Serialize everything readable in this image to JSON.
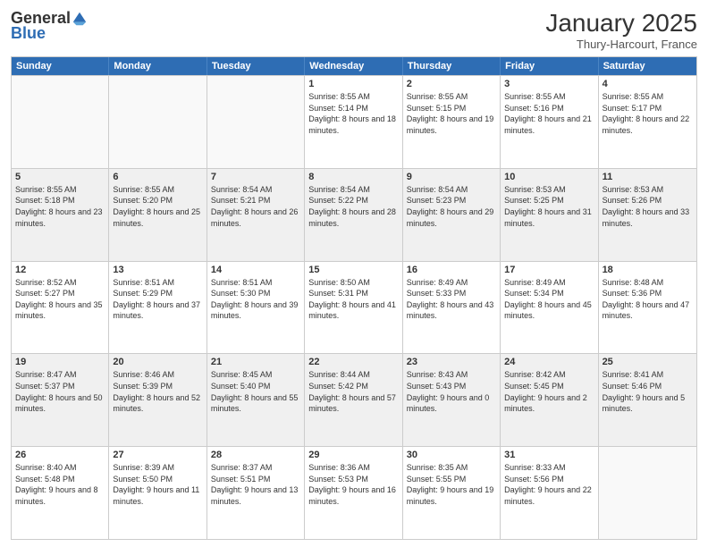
{
  "logo": {
    "general": "General",
    "blue": "Blue"
  },
  "header": {
    "month": "January 2025",
    "location": "Thury-Harcourt, France"
  },
  "weekdays": [
    "Sunday",
    "Monday",
    "Tuesday",
    "Wednesday",
    "Thursday",
    "Friday",
    "Saturday"
  ],
  "rows": [
    [
      {
        "day": "",
        "sunrise": "",
        "sunset": "",
        "daylight": "",
        "empty": true
      },
      {
        "day": "",
        "sunrise": "",
        "sunset": "",
        "daylight": "",
        "empty": true
      },
      {
        "day": "",
        "sunrise": "",
        "sunset": "",
        "daylight": "",
        "empty": true
      },
      {
        "day": "1",
        "sunrise": "Sunrise: 8:55 AM",
        "sunset": "Sunset: 5:14 PM",
        "daylight": "Daylight: 8 hours and 18 minutes."
      },
      {
        "day": "2",
        "sunrise": "Sunrise: 8:55 AM",
        "sunset": "Sunset: 5:15 PM",
        "daylight": "Daylight: 8 hours and 19 minutes."
      },
      {
        "day": "3",
        "sunrise": "Sunrise: 8:55 AM",
        "sunset": "Sunset: 5:16 PM",
        "daylight": "Daylight: 8 hours and 21 minutes."
      },
      {
        "day": "4",
        "sunrise": "Sunrise: 8:55 AM",
        "sunset": "Sunset: 5:17 PM",
        "daylight": "Daylight: 8 hours and 22 minutes."
      }
    ],
    [
      {
        "day": "5",
        "sunrise": "Sunrise: 8:55 AM",
        "sunset": "Sunset: 5:18 PM",
        "daylight": "Daylight: 8 hours and 23 minutes.",
        "shaded": true
      },
      {
        "day": "6",
        "sunrise": "Sunrise: 8:55 AM",
        "sunset": "Sunset: 5:20 PM",
        "daylight": "Daylight: 8 hours and 25 minutes.",
        "shaded": true
      },
      {
        "day": "7",
        "sunrise": "Sunrise: 8:54 AM",
        "sunset": "Sunset: 5:21 PM",
        "daylight": "Daylight: 8 hours and 26 minutes.",
        "shaded": true
      },
      {
        "day": "8",
        "sunrise": "Sunrise: 8:54 AM",
        "sunset": "Sunset: 5:22 PM",
        "daylight": "Daylight: 8 hours and 28 minutes.",
        "shaded": true
      },
      {
        "day": "9",
        "sunrise": "Sunrise: 8:54 AM",
        "sunset": "Sunset: 5:23 PM",
        "daylight": "Daylight: 8 hours and 29 minutes.",
        "shaded": true
      },
      {
        "day": "10",
        "sunrise": "Sunrise: 8:53 AM",
        "sunset": "Sunset: 5:25 PM",
        "daylight": "Daylight: 8 hours and 31 minutes.",
        "shaded": true
      },
      {
        "day": "11",
        "sunrise": "Sunrise: 8:53 AM",
        "sunset": "Sunset: 5:26 PM",
        "daylight": "Daylight: 8 hours and 33 minutes.",
        "shaded": true
      }
    ],
    [
      {
        "day": "12",
        "sunrise": "Sunrise: 8:52 AM",
        "sunset": "Sunset: 5:27 PM",
        "daylight": "Daylight: 8 hours and 35 minutes."
      },
      {
        "day": "13",
        "sunrise": "Sunrise: 8:51 AM",
        "sunset": "Sunset: 5:29 PM",
        "daylight": "Daylight: 8 hours and 37 minutes."
      },
      {
        "day": "14",
        "sunrise": "Sunrise: 8:51 AM",
        "sunset": "Sunset: 5:30 PM",
        "daylight": "Daylight: 8 hours and 39 minutes."
      },
      {
        "day": "15",
        "sunrise": "Sunrise: 8:50 AM",
        "sunset": "Sunset: 5:31 PM",
        "daylight": "Daylight: 8 hours and 41 minutes."
      },
      {
        "day": "16",
        "sunrise": "Sunrise: 8:49 AM",
        "sunset": "Sunset: 5:33 PM",
        "daylight": "Daylight: 8 hours and 43 minutes."
      },
      {
        "day": "17",
        "sunrise": "Sunrise: 8:49 AM",
        "sunset": "Sunset: 5:34 PM",
        "daylight": "Daylight: 8 hours and 45 minutes."
      },
      {
        "day": "18",
        "sunrise": "Sunrise: 8:48 AM",
        "sunset": "Sunset: 5:36 PM",
        "daylight": "Daylight: 8 hours and 47 minutes."
      }
    ],
    [
      {
        "day": "19",
        "sunrise": "Sunrise: 8:47 AM",
        "sunset": "Sunset: 5:37 PM",
        "daylight": "Daylight: 8 hours and 50 minutes.",
        "shaded": true
      },
      {
        "day": "20",
        "sunrise": "Sunrise: 8:46 AM",
        "sunset": "Sunset: 5:39 PM",
        "daylight": "Daylight: 8 hours and 52 minutes.",
        "shaded": true
      },
      {
        "day": "21",
        "sunrise": "Sunrise: 8:45 AM",
        "sunset": "Sunset: 5:40 PM",
        "daylight": "Daylight: 8 hours and 55 minutes.",
        "shaded": true
      },
      {
        "day": "22",
        "sunrise": "Sunrise: 8:44 AM",
        "sunset": "Sunset: 5:42 PM",
        "daylight": "Daylight: 8 hours and 57 minutes.",
        "shaded": true
      },
      {
        "day": "23",
        "sunrise": "Sunrise: 8:43 AM",
        "sunset": "Sunset: 5:43 PM",
        "daylight": "Daylight: 9 hours and 0 minutes.",
        "shaded": true
      },
      {
        "day": "24",
        "sunrise": "Sunrise: 8:42 AM",
        "sunset": "Sunset: 5:45 PM",
        "daylight": "Daylight: 9 hours and 2 minutes.",
        "shaded": true
      },
      {
        "day": "25",
        "sunrise": "Sunrise: 8:41 AM",
        "sunset": "Sunset: 5:46 PM",
        "daylight": "Daylight: 9 hours and 5 minutes.",
        "shaded": true
      }
    ],
    [
      {
        "day": "26",
        "sunrise": "Sunrise: 8:40 AM",
        "sunset": "Sunset: 5:48 PM",
        "daylight": "Daylight: 9 hours and 8 minutes."
      },
      {
        "day": "27",
        "sunrise": "Sunrise: 8:39 AM",
        "sunset": "Sunset: 5:50 PM",
        "daylight": "Daylight: 9 hours and 11 minutes."
      },
      {
        "day": "28",
        "sunrise": "Sunrise: 8:37 AM",
        "sunset": "Sunset: 5:51 PM",
        "daylight": "Daylight: 9 hours and 13 minutes."
      },
      {
        "day": "29",
        "sunrise": "Sunrise: 8:36 AM",
        "sunset": "Sunset: 5:53 PM",
        "daylight": "Daylight: 9 hours and 16 minutes."
      },
      {
        "day": "30",
        "sunrise": "Sunrise: 8:35 AM",
        "sunset": "Sunset: 5:55 PM",
        "daylight": "Daylight: 9 hours and 19 minutes."
      },
      {
        "day": "31",
        "sunrise": "Sunrise: 8:33 AM",
        "sunset": "Sunset: 5:56 PM",
        "daylight": "Daylight: 9 hours and 22 minutes."
      },
      {
        "day": "",
        "sunrise": "",
        "sunset": "",
        "daylight": "",
        "empty": true
      }
    ]
  ]
}
